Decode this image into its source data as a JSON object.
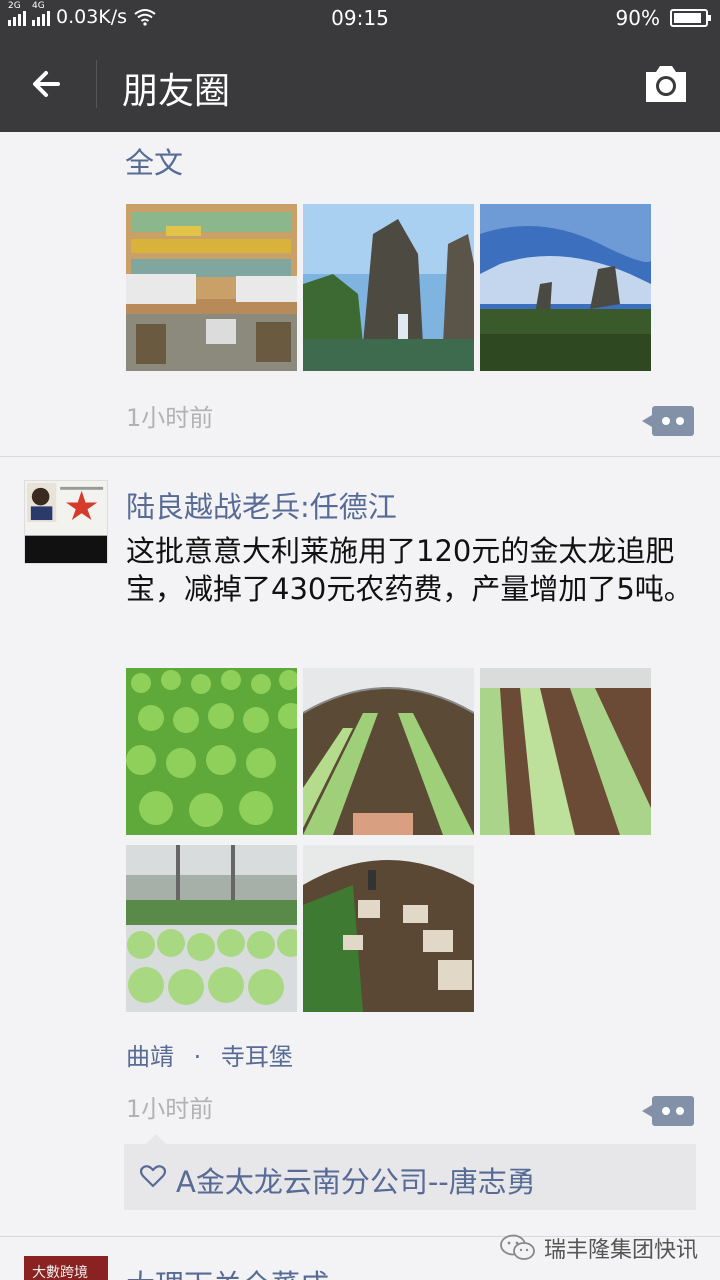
{
  "status": {
    "net1": "2G",
    "net2": "4G",
    "speed": "0.03K/s",
    "time": "09:15",
    "battery": "90%",
    "battery_level": 0.9
  },
  "header": {
    "title": "朋友圈"
  },
  "post1": {
    "full_text_link": "全文",
    "time_ago": "1小时前"
  },
  "post2": {
    "name": "陆良越战老兵:任德江",
    "content": "这批意意大利莱施用了120元的金太龙追肥宝，减掉了430元农药费，产量增加了5吨。",
    "location_city": "曲靖",
    "location_dot": "·",
    "location_place": "寺耳堡",
    "time_ago": "1小时前",
    "likes": "A金太龙云南分公司--唐志勇"
  },
  "post3": {
    "avatar_text": "大數跨境",
    "name_partial": "大理下关全蕃成"
  },
  "watermark": "瑞丰隆集团快讯",
  "colors": {
    "link": "#576b95",
    "bar": "#3a3a3c"
  }
}
